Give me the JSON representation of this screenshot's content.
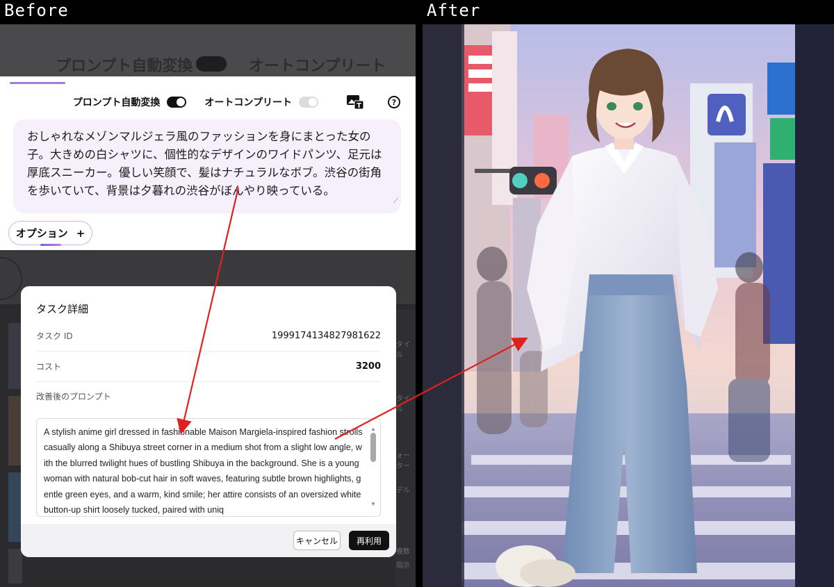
{
  "labels": {
    "before": "Before",
    "after": "After"
  },
  "background_ghost": {
    "toggle_label": "プロンプト自動変換",
    "autocomplete_label": "オートコンプリート"
  },
  "prompt_panel": {
    "auto_convert_label": "プロンプト自動変換",
    "auto_convert_on": true,
    "autocomplete_label": "オートコンプリート",
    "autocomplete_on": false,
    "help_glyph": "?",
    "prompt_text": "おしゃれなメゾンマルジェラ風のファッションを身にまとった女の子。大きめの白シャツに、個性的なデザインのワイドパンツ、足元は厚底スニーカー。優しい笑顔で、髪はナチュラルなボブ。渋谷の街角を歩いていて、背景は夕暮れの渋谷がぼんやり映っている。",
    "option_label": "オプション",
    "option_glyph": "+"
  },
  "side_strip": {
    "t1": "タイル",
    "t2": "タイル",
    "t3": "ォーター",
    "t4": "デル",
    "t5": "複数",
    "t6": "指示"
  },
  "modal": {
    "title": "タスク詳細",
    "task_id_label": "タスク ID",
    "task_id_value": "1999174134827981622",
    "cost_label": "コスト",
    "cost_value": "3200",
    "improved_prompt_label": "改善後のプロンプト",
    "improved_prompt": "A stylish anime girl dressed in fashionable Maison Margiela-inspired fashion strolls casually along a Shibuya street corner in a medium shot from a slight low angle, with the blurred twilight hues of bustling Shibuya in the background. She is a young woman with natural bob-cut hair in soft waves, featuring subtle brown highlights, gentle green eyes, and a warm, kind smile; her attire consists of an oversized white button-up shirt loosely tucked, paired with uniq",
    "cancel_label": "キャンセル",
    "reuse_label": "再利用"
  },
  "colors": {
    "accent": "#9b7ce0",
    "arrow": "#e02020",
    "prompt_bg": "#f6f0fc"
  }
}
